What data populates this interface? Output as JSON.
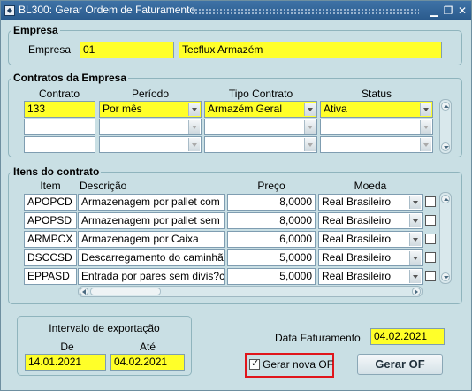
{
  "window": {
    "title": "BL300: Gerar Ordem de Faturamento",
    "controls": [
      "minimize-icon",
      "maximize-icon",
      "close-icon"
    ]
  },
  "empresa": {
    "group_title": "Empresa",
    "label": "Empresa",
    "code": "01",
    "name": "Tecflux Armazém"
  },
  "contratos": {
    "group_title": "Contratos da Empresa",
    "headers": [
      "Contrato",
      "Período",
      "Tipo Contrato",
      "Status"
    ],
    "rows": [
      {
        "contrato": "133",
        "periodo": "Por mês",
        "tipo": "Armazém Geral",
        "status": "Ativa"
      },
      {
        "contrato": "",
        "periodo": "",
        "tipo": "",
        "status": ""
      },
      {
        "contrato": "",
        "periodo": "",
        "tipo": "",
        "status": ""
      }
    ]
  },
  "itens": {
    "group_title": "Itens do contrato",
    "headers": [
      "Item",
      "Descrição",
      "Preço",
      "Moeda"
    ],
    "rows": [
      {
        "item": "APOPCD",
        "descricao": "Armazenagem por pallet com",
        "preco": "8,0000",
        "moeda": "Real Brasileiro"
      },
      {
        "item": "APOPSD",
        "descricao": "Armazenagem por pallet sem",
        "preco": "8,0000",
        "moeda": "Real Brasileiro"
      },
      {
        "item": "ARMPCX",
        "descricao": "Armazenagem por Caixa",
        "preco": "6,0000",
        "moeda": "Real Brasileiro"
      },
      {
        "item": "DSCCSD",
        "descricao": "Descarregamento do caminhão",
        "preco": "5,0000",
        "moeda": "Real Brasileiro"
      },
      {
        "item": "EPPASD",
        "descricao": "Entrada por pares sem divis?c",
        "preco": "5,0000",
        "moeda": "Real Brasileiro"
      }
    ]
  },
  "intervalo": {
    "group_title": "Intervalo de exportação",
    "de_label": "De",
    "ate_label": "Até",
    "de_value": "14.01.2021",
    "ate_value": "04.02.2021"
  },
  "faturamento": {
    "label": "Data Faturamento",
    "value": "04.02.2021"
  },
  "gerar_nova_of": {
    "label": "Gerar nova OF",
    "checked": true
  },
  "gerar_of_button": "Gerar OF",
  "colors": {
    "required_field": "#ffff29",
    "background": "#c9dfe4",
    "titlebar": "#2a5a8c",
    "highlight": "#e0151b"
  }
}
